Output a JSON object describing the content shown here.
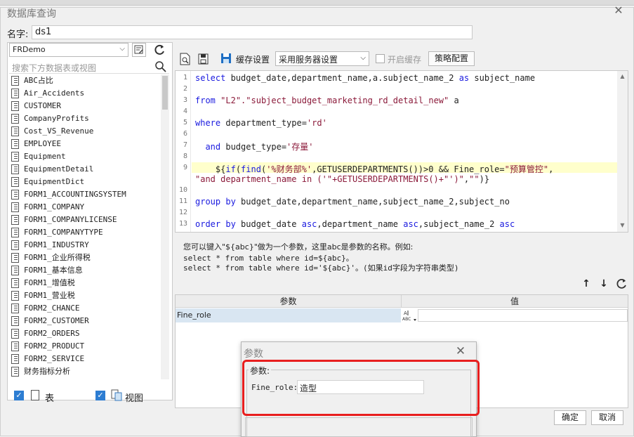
{
  "dialog": {
    "title": "数据库查询",
    "close_glyph": "✕",
    "name_label": "名字:",
    "name_value": "ds1"
  },
  "left": {
    "datasource": "FRDemo",
    "search_placeholder": "搜索下方数据表或视图",
    "tables": [
      "ABC占比",
      "Air_Accidents",
      "CUSTOMER",
      "CompanyProfits",
      "Cost_VS_Revenue",
      "EMPLOYEE",
      "Equipment",
      "EquipmentDetail",
      "EquipmentDict",
      "FORM1_ACCOUNTINGSYSTEM",
      "FORM1_COMPANY",
      "FORM1_COMPANYLICENSE",
      "FORM1_COMPANYTYPE",
      "FORM1_INDUSTRY",
      "FORM1_企业所得税",
      "FORM1_基本信息",
      "FORM1_增值税",
      "FORM1_营业税",
      "FORM2_CHANCE",
      "FORM2_CUSTOMER",
      "FORM2_ORDERS",
      "FORM2_PRODUCT",
      "FORM2_SERVICE",
      "财务指标分析"
    ],
    "check_table_label": "表",
    "check_view_label": "视图"
  },
  "toolbar": {
    "cache_label": "缓存设置",
    "server_setting": "采用服务器设置",
    "enable_cache_label": "开启缓存",
    "policy_label": "策略配置"
  },
  "sql": {
    "line_numbers": [
      "1",
      "2",
      "3",
      "4",
      "5",
      "6",
      "7",
      "8",
      "9",
      "",
      "10",
      "11",
      "12",
      "13"
    ],
    "l1a": "select",
    "l1b": " budget_date,department_name,a.subject_name_2 ",
    "l1c": "as",
    "l1d": " subject_name",
    "l3a": "from",
    "l3b": " ",
    "l3c": "\"L2\".\"subject_budget_marketing_rd_detail_new\"",
    "l3d": " a",
    "l5a": "where",
    "l5b": " department_type=",
    "l5c": "'rd'",
    "l7a": "  and",
    "l7b": " budget_type=",
    "l7c": "'存量'",
    "l9a": "    ${",
    "l9b": "if",
    "l9c": "(",
    "l9d": "find",
    "l9e": "(",
    "l9f": "'%财务部%'",
    "l9g": ",GETUSERDEPARTMENTS())>0 && Fine_role=",
    "l9h": "\"预算管控\"",
    "l9i": ",",
    "l9j": "\"and department_name in ('\"+GETUSERDEPARTMENTS()+\"')\"",
    "l9k": ",",
    "l9l": "\"\"",
    "l9m": ")}",
    "l11a": "group by",
    "l11b": " budget_date,department_name,subject_name_2,subject_no",
    "l13a": "order by",
    "l13b": " budget_date ",
    "l13c": "asc",
    "l13d": ",department_name ",
    "l13e": "asc",
    "l13f": ",subject_name_2 ",
    "l13g": "asc"
  },
  "help": {
    "line1": "您可以键入\"${abc}\"做为一个参数，这里abc是参数的名称。例如:",
    "line2": "select * from table where id=${abc}。",
    "line3": "select * from table where id='${abc}'。(如果id字段为字符串类型)"
  },
  "params": {
    "col_name": "参数",
    "col_value": "值",
    "rows": [
      {
        "name": "Fine_role",
        "type_label": "A\nABC",
        "value": ""
      }
    ]
  },
  "buttons": {
    "ok": "确定",
    "cancel": "取消"
  },
  "popup": {
    "title": "参数",
    "close_glyph": "✕",
    "group_label": "参数:",
    "param_label": "Fine_role:",
    "param_value": "造型"
  },
  "colors": {
    "highlight_border": "#e81e1e",
    "keyword": "#1a1adf",
    "string": "#8b1a3a",
    "selected_row": "#d9e6f2",
    "checkbox": "#2d7dd2"
  }
}
